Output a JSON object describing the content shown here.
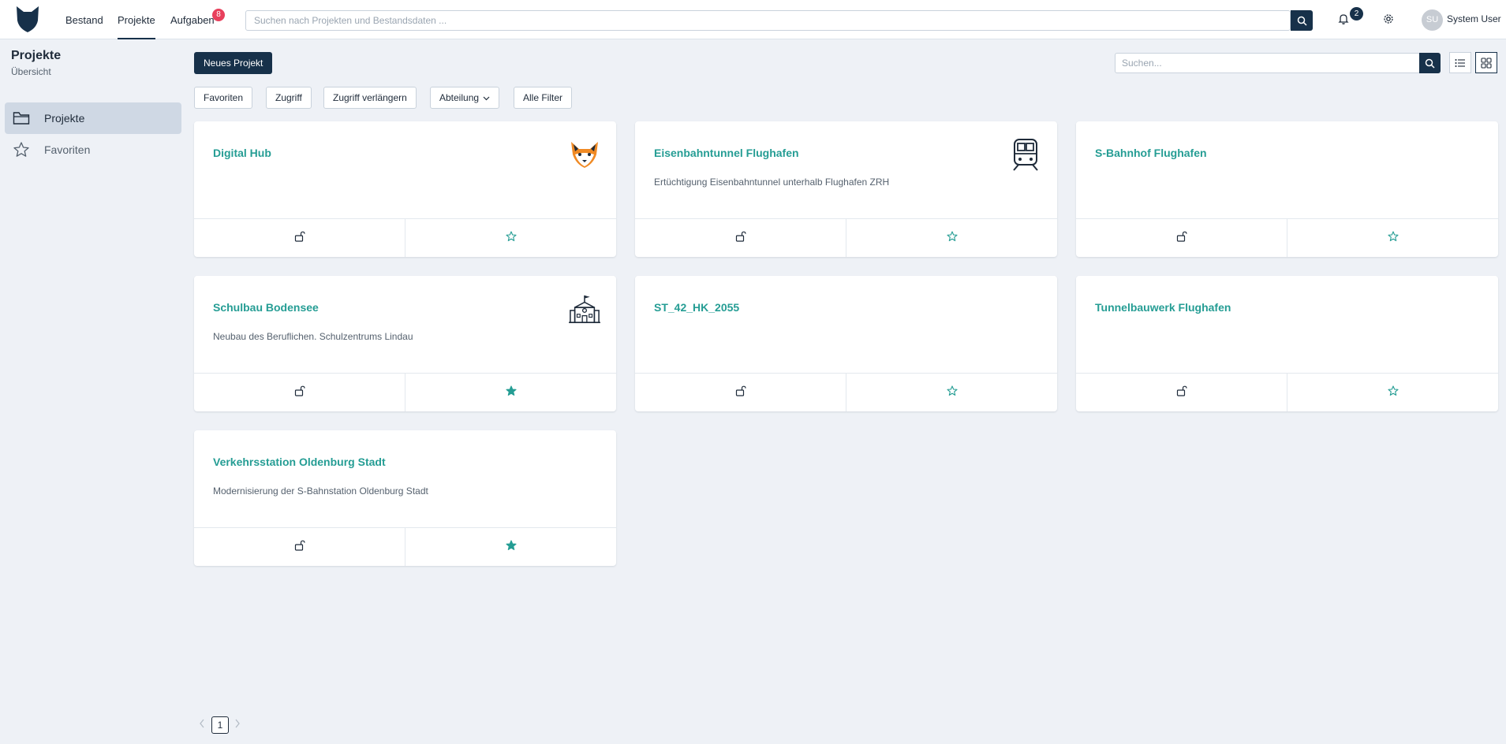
{
  "nav": {
    "items": [
      {
        "label": "Bestand"
      },
      {
        "label": "Projekte",
        "active": true
      },
      {
        "label": "Aufgaben",
        "badge": "8"
      }
    ],
    "search_placeholder": "Suchen nach Projekten und Bestandsdaten ...",
    "notifications_badge": "2",
    "user_initials": "SU",
    "user_name": "System User"
  },
  "sidebar": {
    "title": "Projekte",
    "subtitle": "Übersicht",
    "items": [
      {
        "label": "Projekte",
        "icon": "folder-icon",
        "active": true
      },
      {
        "label": "Favoriten",
        "icon": "star-icon",
        "active": false
      }
    ]
  },
  "toolbar": {
    "new_project_label": "Neues Projekt",
    "search_placeholder": "Suchen...",
    "filters": [
      "Favoriten",
      "Zugriff",
      "Zugriff verlängern",
      "Abteilung",
      "Alle Filter"
    ]
  },
  "projects": [
    {
      "title": "Digital Hub",
      "description": "",
      "icon": "fox-icon",
      "favorite": false
    },
    {
      "title": "Eisenbahntunnel Flughafen",
      "description": "Ertüchtigung Eisenbahntunnel unterhalb Flughafen ZRH",
      "icon": "train-icon",
      "favorite": false
    },
    {
      "title": "S-Bahnhof Flughafen",
      "description": "",
      "icon": "",
      "favorite": false
    },
    {
      "title": "Schulbau Bodensee",
      "description": "Neubau des Beruflichen. Schulzentrums Lindau",
      "icon": "school-icon",
      "favorite": true
    },
    {
      "title": "ST_42_HK_2055",
      "description": "",
      "icon": "",
      "favorite": false
    },
    {
      "title": "Tunnelbauwerk Flughafen",
      "description": "",
      "icon": "",
      "favorite": false
    },
    {
      "title": "Verkehrsstation Oldenburg Stadt",
      "description": "Modernisierung der S-Bahnstation Oldenburg Stadt",
      "icon": "",
      "favorite": true
    }
  ],
  "pagination": {
    "current_page": "1"
  },
  "colors": {
    "primary": "#17314a",
    "accent": "#259d94",
    "badge": "#e8405c",
    "background": "#eef1f6"
  }
}
